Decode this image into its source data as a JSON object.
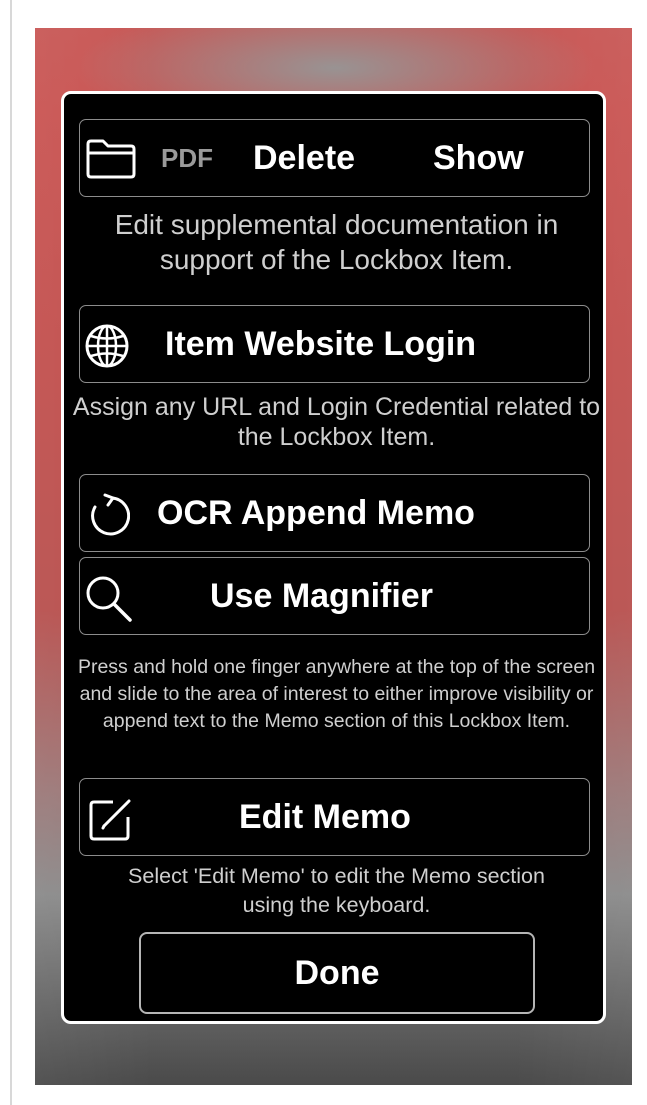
{
  "attachments": {
    "pdf_label": "PDF",
    "delete_label": "Delete",
    "show_label": "Show",
    "description": "Edit supplemental documentation in support of the Lockbox Item."
  },
  "website_login": {
    "label": "Item Website Login",
    "description": "Assign any URL and Login Credential related to the Lockbox Item."
  },
  "ocr": {
    "label": "OCR Append Memo"
  },
  "magnifier": {
    "label": "Use Magnifier",
    "description": "Press and hold one finger anywhere at the top of the screen and slide to the area of interest to either improve visibility or append text to the Memo section of this Lockbox Item."
  },
  "edit_memo": {
    "label": "Edit Memo",
    "description": "Select 'Edit Memo' to edit the Memo section using the keyboard."
  },
  "done": {
    "label": "Done"
  },
  "colors": {
    "dialog_background": "#000000",
    "dialog_border": "#ffffff",
    "button_border": "#8c8c8c",
    "text": "#ffffff",
    "description_text": "#cfcfcf",
    "pdf_text": "#9a9a9a",
    "backdrop_top": "#c85856",
    "backdrop_bottom": "#4a4a4a"
  },
  "icons": {
    "attachments": "folder-icon",
    "website_login": "globe-icon",
    "ocr": "refresh-icon",
    "magnifier": "magnifier-icon",
    "edit_memo": "edit-icon"
  }
}
